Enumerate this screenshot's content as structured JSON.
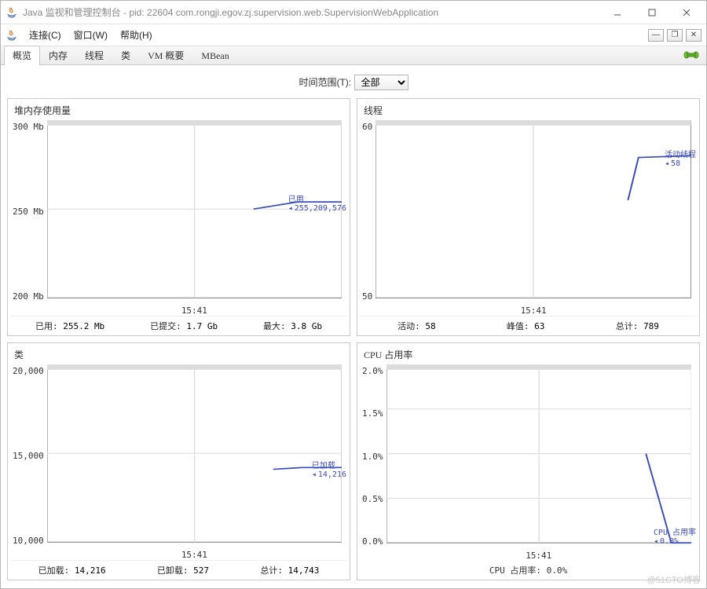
{
  "window": {
    "title": "Java 监视和管理控制台 - pid: 22604 com.rongji.egov.zj.supervision.web.SupervisionWebApplication"
  },
  "menu": {
    "connect": "连接(C)",
    "window": "窗口(W)",
    "help": "帮助(H)"
  },
  "tabs": {
    "overview": "概览",
    "memory": "内存",
    "threads": "线程",
    "classes": "类",
    "vm": "VM 概要",
    "mbeans": "MBean"
  },
  "timerange": {
    "label": "时间范围(T):",
    "value": "全部"
  },
  "heap": {
    "title": "堆内存使用量",
    "yticks": [
      "300 Mb",
      "250 Mb",
      "200 Mb"
    ],
    "xtick": "15:41",
    "side_label": "已用",
    "side_value": "255,209,576",
    "stats": {
      "used_l": "已用:",
      "used_v": "255.2 Mb",
      "commit_l": "已提交:",
      "commit_v": "1.7 Gb",
      "max_l": "最大:",
      "max_v": "3.8 Gb"
    }
  },
  "threads": {
    "title": "线程",
    "yticks": [
      "60",
      "50"
    ],
    "xtick": "15:41",
    "side_label": "活动线程",
    "side_value": "58",
    "stats": {
      "live_l": "活动:",
      "live_v": "58",
      "peak_l": "峰值:",
      "peak_v": "63",
      "total_l": "总计:",
      "total_v": "789"
    }
  },
  "classes": {
    "title": "类",
    "yticks": [
      "20,000",
      "15,000",
      "10,000"
    ],
    "xtick": "15:41",
    "side_label": "已加载",
    "side_value": "14,216",
    "stats": {
      "loaded_l": "已加载:",
      "loaded_v": "14,216",
      "unloaded_l": "已卸载:",
      "unloaded_v": "527",
      "total_l": "总计:",
      "total_v": "14,743"
    }
  },
  "cpu": {
    "title": "CPU 占用率",
    "yticks": [
      "2.0%",
      "1.5%",
      "1.0%",
      "0.5%",
      "0.0%"
    ],
    "xtick": "15:41",
    "side_label": "CPU 占用率",
    "side_value": "0.0%",
    "stats_line": "CPU 占用率: 0.0%"
  },
  "watermark": "@51CTO博客",
  "chart_data": [
    {
      "type": "line",
      "title": "堆内存使用量",
      "ylabel": "Mb",
      "ylim": [
        200,
        300
      ],
      "x": [
        "15:41"
      ],
      "series": [
        {
          "name": "已用",
          "values_bytes": [
            255209576
          ],
          "values_mb": [
            255.2
          ]
        }
      ]
    },
    {
      "type": "line",
      "title": "线程",
      "ylim": [
        50,
        60
      ],
      "x": [
        "15:41"
      ],
      "series": [
        {
          "name": "活动线程",
          "values": [
            58
          ]
        }
      ]
    },
    {
      "type": "line",
      "title": "类",
      "ylim": [
        10000,
        20000
      ],
      "x": [
        "15:41"
      ],
      "series": [
        {
          "name": "已加载",
          "values": [
            14216
          ]
        }
      ]
    },
    {
      "type": "line",
      "title": "CPU 占用率",
      "ylabel": "%",
      "ylim": [
        0,
        2
      ],
      "x": [
        "15:41"
      ],
      "series": [
        {
          "name": "CPU 占用率",
          "values": [
            0.0
          ]
        }
      ]
    }
  ]
}
